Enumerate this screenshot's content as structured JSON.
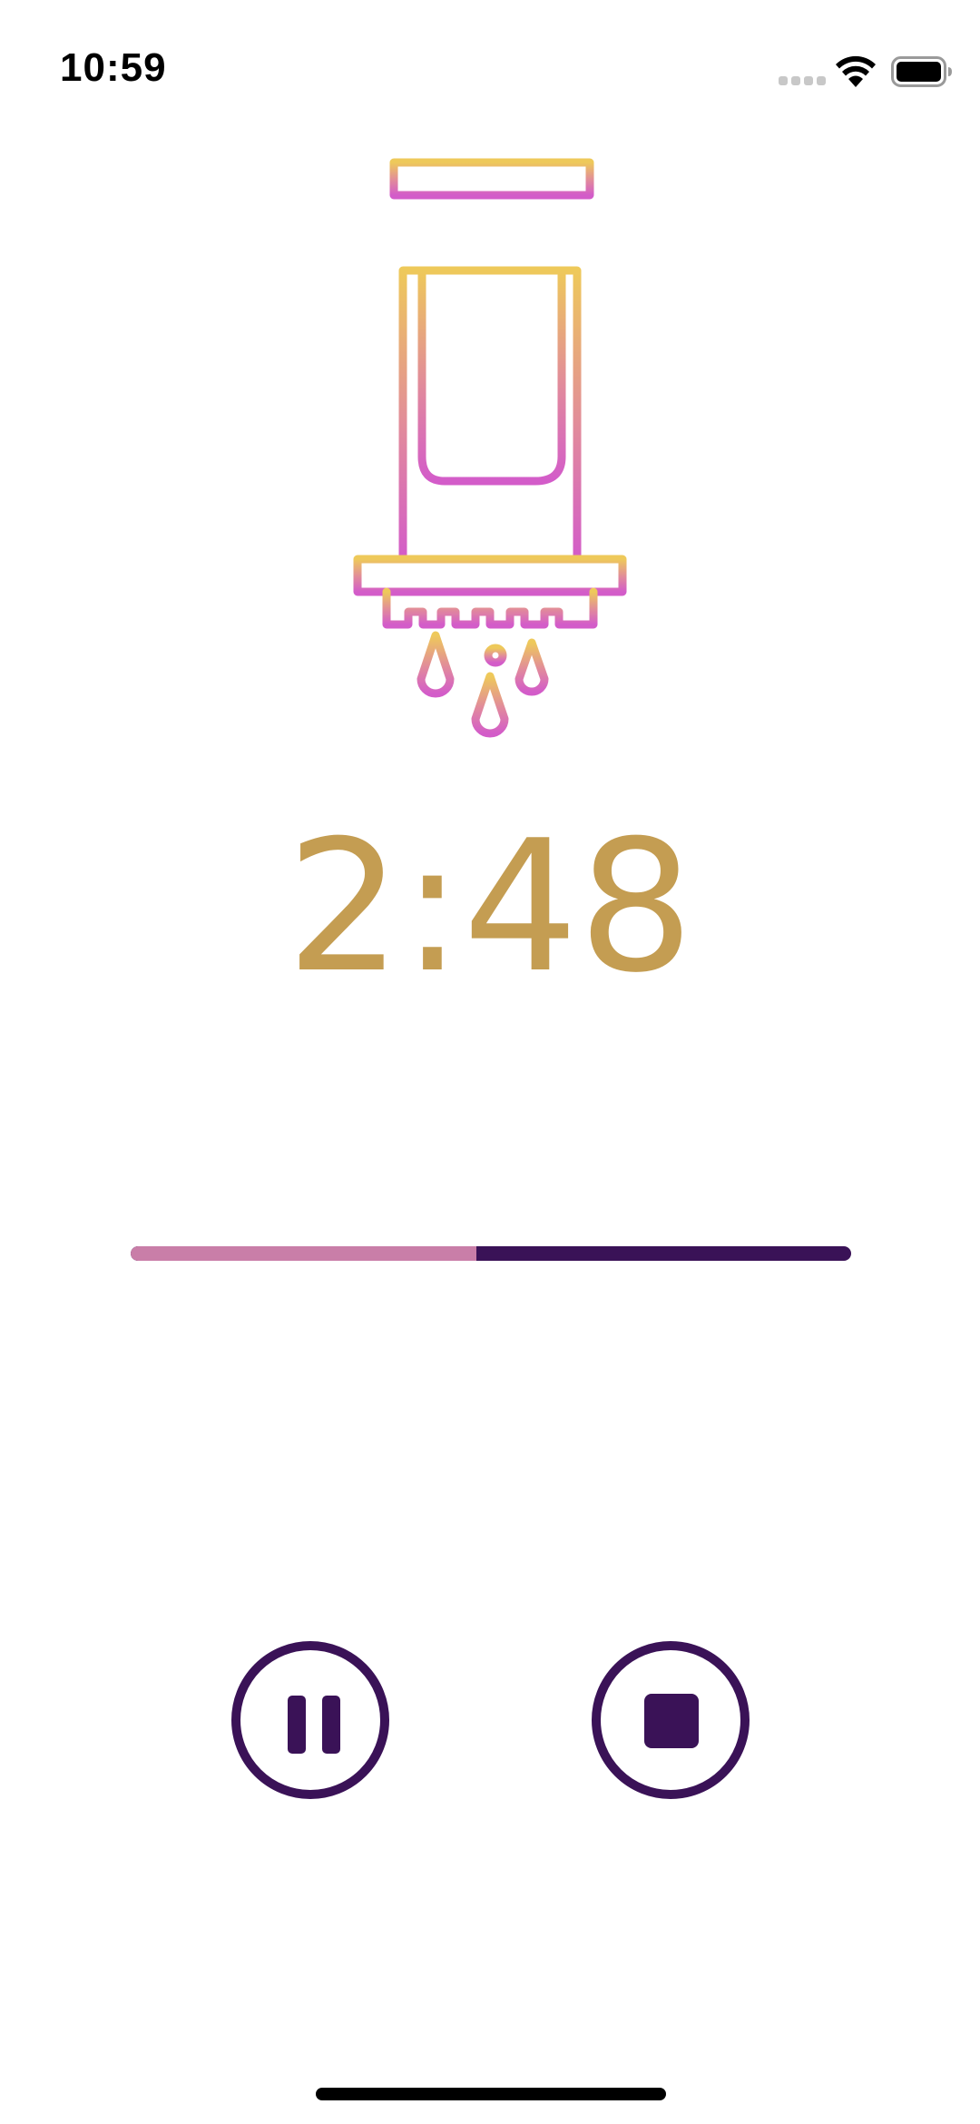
{
  "status_bar": {
    "time": "10:59"
  },
  "timer": {
    "display": "2:48",
    "progress": 0.48
  },
  "controls": {
    "pause_icon": "pause-icon",
    "stop_icon": "stop-icon"
  },
  "colors": {
    "accent_gold": "#C49D52",
    "dark_purple": "#3A1257",
    "progress_pink": "#C97EA8",
    "gradient_top": "#EEC95A",
    "gradient_bottom": "#D35CC9"
  }
}
